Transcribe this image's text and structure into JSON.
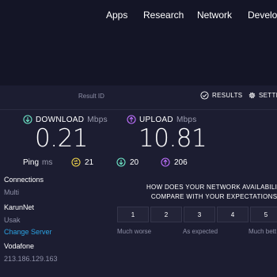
{
  "nav": {
    "items": [
      {
        "label": "Apps"
      },
      {
        "label": "Research"
      },
      {
        "label": "Network"
      },
      {
        "label": "Develo"
      }
    ]
  },
  "result_bar": {
    "result_id_label": "Result ID",
    "results_label": "RESULTS",
    "settings_label": "SETTI"
  },
  "download": {
    "label": "DOWNLOAD",
    "unit": "Mbps",
    "value": "0.21",
    "icon": "download-arrow-icon",
    "color": "#6ee7c8"
  },
  "upload": {
    "label": "UPLOAD",
    "unit": "Mbps",
    "value": "10.81",
    "icon": "upload-arrow-icon",
    "color": "#bf71ff"
  },
  "ping": {
    "label": "Ping",
    "unit": "ms",
    "idle": {
      "value": "21",
      "icon": "idle-latency-icon",
      "color": "#f1d54b"
    },
    "download": {
      "value": "20",
      "icon": "download-latency-icon",
      "color": "#6ee7c8"
    },
    "upload": {
      "value": "206",
      "icon": "upload-latency-icon",
      "color": "#bf71ff"
    }
  },
  "connections": {
    "title": "Connections",
    "value": "Multi"
  },
  "server": {
    "name": "KarunNet",
    "location": "Usak",
    "change_label": "Change Server"
  },
  "provider": {
    "name": "Vodafone",
    "ip": "213.186.129.163"
  },
  "survey": {
    "question_line1": "HOW DOES YOUR NETWORK AVAILABILITY",
    "question_line2": "COMPARE WITH YOUR EXPECTATIONS?",
    "options": [
      "1",
      "2",
      "3",
      "4",
      "5"
    ],
    "low_label": "Much worse",
    "mid_label": "As expected",
    "high_label": "Much bett"
  },
  "colors": {
    "background": "#141526",
    "panel": "#1c1d31",
    "link": "#2ba3e3"
  }
}
